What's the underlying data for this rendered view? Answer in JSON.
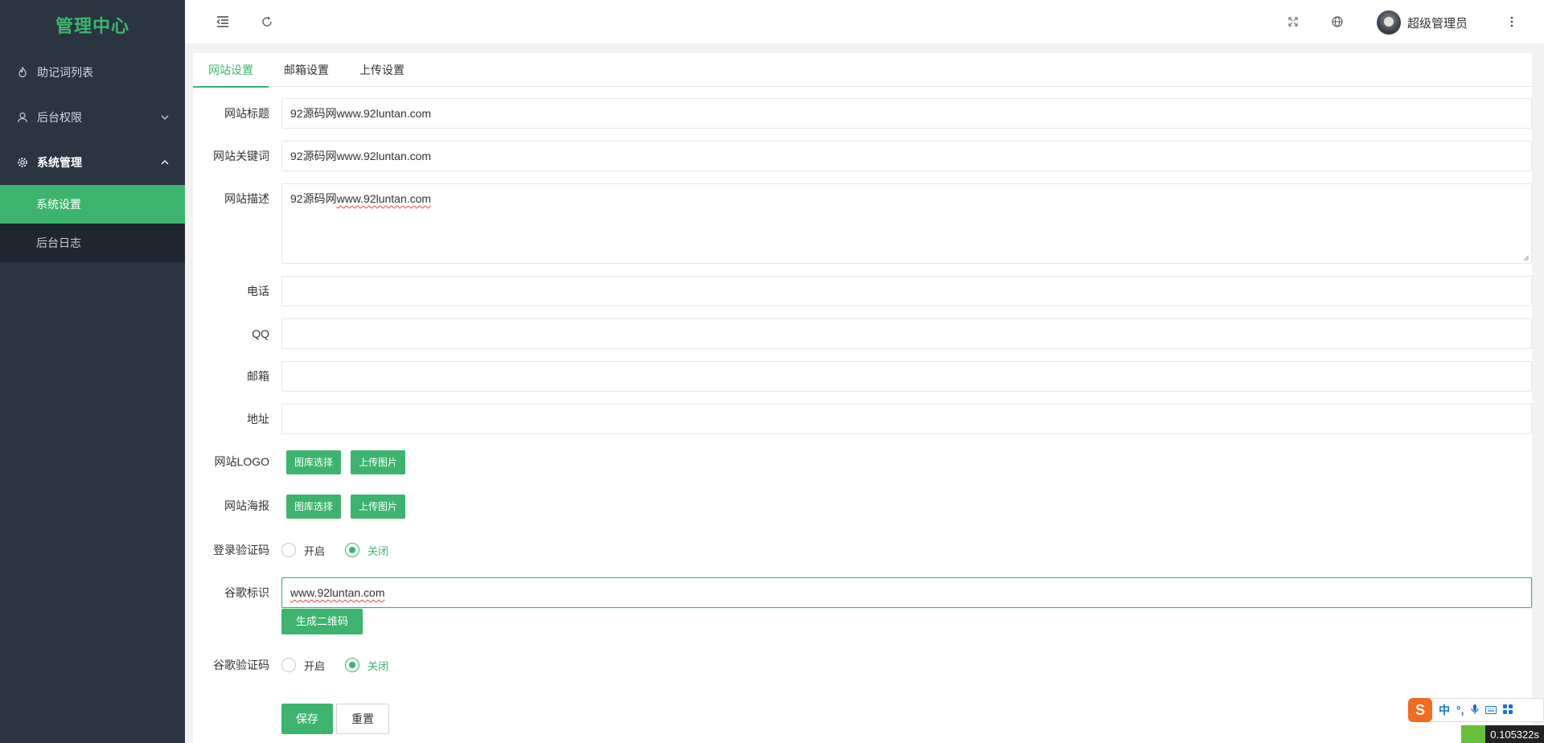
{
  "app": {
    "title": "管理中心"
  },
  "sidebar": {
    "items": [
      {
        "label": "助记词列表",
        "icon": "fire-icon"
      },
      {
        "label": "后台权限",
        "icon": "user-icon",
        "chevron": "down"
      },
      {
        "label": "系统管理",
        "icon": "gear-icon",
        "chevron": "up"
      }
    ],
    "subitems": [
      {
        "label": "系统设置",
        "active": true
      },
      {
        "label": "后台日志",
        "active": false
      }
    ]
  },
  "header": {
    "icons": [
      "menu-toggle-icon",
      "refresh-icon",
      "fullscreen-icon",
      "globe-icon",
      "more-icon"
    ],
    "user_name": "超级管理员"
  },
  "tabs": [
    {
      "label": "网站设置",
      "active": true
    },
    {
      "label": "邮箱设置",
      "active": false
    },
    {
      "label": "上传设置",
      "active": false
    }
  ],
  "form": {
    "site_title": {
      "label": "网站标题",
      "value": "92源码网www.92luntan.com"
    },
    "site_keywords": {
      "label": "网站关键词",
      "value": "92源码网www.92luntan.com"
    },
    "site_desc": {
      "label": "网站描述",
      "value_prefix": "92源码网",
      "value_suffix": "www.92luntan.com"
    },
    "phone": {
      "label": "电话",
      "value": ""
    },
    "qq": {
      "label": "QQ",
      "value": ""
    },
    "email": {
      "label": "邮箱",
      "value": ""
    },
    "address": {
      "label": "地址",
      "value": ""
    },
    "logo": {
      "label": "网站LOGO",
      "btn_library": "图库选择",
      "btn_upload": "上传图片"
    },
    "poster": {
      "label": "网站海报",
      "btn_library": "图库选择",
      "btn_upload": "上传图片"
    },
    "login_captcha": {
      "label": "登录验证码",
      "on": "开启",
      "off": "关闭",
      "selected": "off"
    },
    "google_id": {
      "label": "谷歌标识",
      "value": "www.92luntan.com",
      "btn_qr": "生成二维码"
    },
    "google_captcha": {
      "label": "谷歌验证码",
      "on": "开启",
      "off": "关闭",
      "selected": "off"
    },
    "save_label": "保存",
    "reset_label": "重置"
  },
  "ime": {
    "logo": "S",
    "mode": "中",
    "punct": "°,"
  },
  "timer": {
    "text": "0.105322s"
  },
  "colors": {
    "accent": "#3cb46e",
    "sidebar_bg": "#2a3541"
  }
}
